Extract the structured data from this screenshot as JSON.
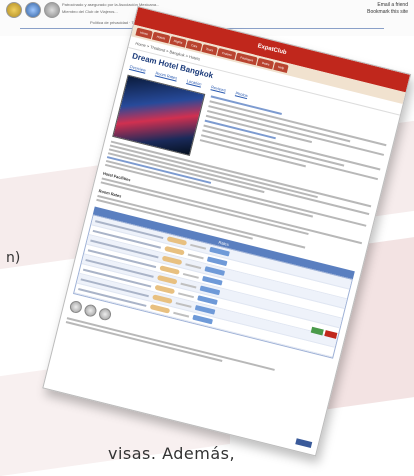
{
  "top_strip": {
    "line1": "Patrocinado y asegurado por la Asociación Mexicana...",
    "line2": "Miembro del Club de Viajeros...",
    "line3": "Política de privacidad · Términos · Contacto",
    "right_links": [
      "Email a friend",
      "Bookmark this site"
    ]
  },
  "screenshot": {
    "header": "ExpatClub",
    "tabs": [
      "Home",
      "Hotels",
      "Flights",
      "Cars",
      "Tours",
      "Cruises",
      "Packages",
      "Deals",
      "Help"
    ],
    "breadcrumb": "Home > Thailand > Bangkok > Hotels",
    "title": "Dream Hotel Bangkok",
    "subnav": [
      "Overview",
      "Room Rates",
      "Location",
      "Reviews",
      "Photos"
    ],
    "section_facilities": "Hotel Facilities",
    "section_rates": "Room Rates",
    "table_header": "Rates"
  },
  "fragments": {
    "paren": "n)",
    "bottom": "visas. Además,"
  }
}
